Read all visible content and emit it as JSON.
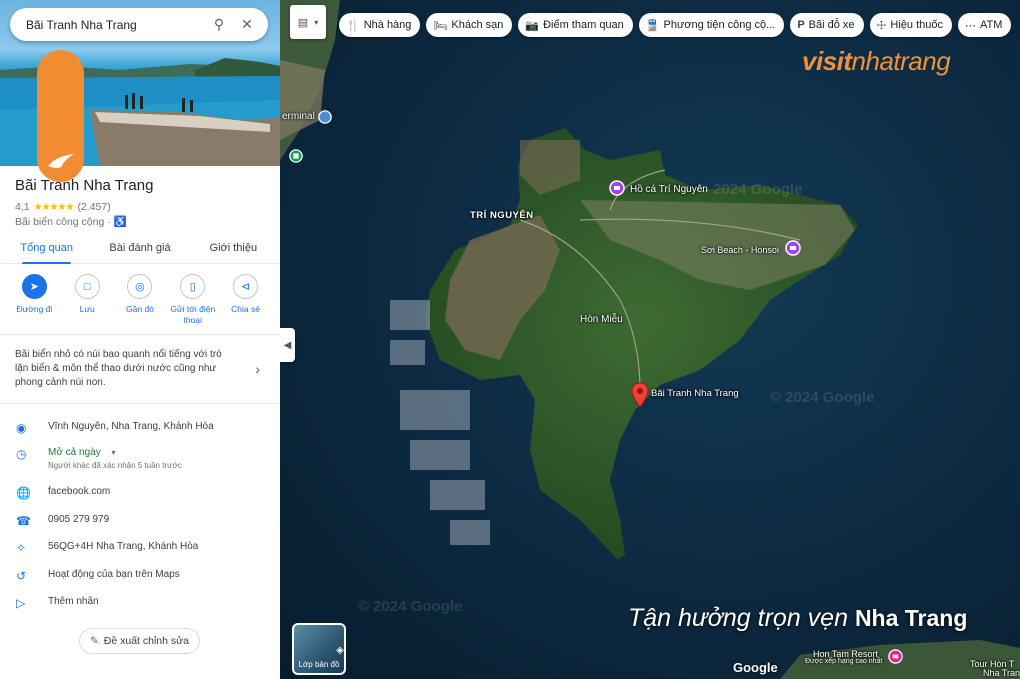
{
  "search": {
    "value": "Bãi Tranh Nha Trang"
  },
  "place": {
    "title": "Bãi Tranh Nha Trang",
    "rating": "4,1",
    "stars": "★★★★★",
    "review_count": "(2.457)",
    "category": "Bãi biển công cộng",
    "accessibility_icon": "accessible-icon"
  },
  "tabs": [
    {
      "label": "Tổng quan",
      "active": true
    },
    {
      "label": "Bài đánh giá",
      "active": false
    },
    {
      "label": "Giới thiệu",
      "active": false
    }
  ],
  "actions": [
    {
      "label": "Đường đi",
      "icon": "directions-icon"
    },
    {
      "label": "Lưu",
      "icon": "bookmark-icon"
    },
    {
      "label": "Gần đó",
      "icon": "nearby-icon"
    },
    {
      "label": "Gửi tới điện thoại",
      "icon": "send-to-phone-icon"
    },
    {
      "label": "Chia sẻ",
      "icon": "share-icon"
    }
  ],
  "description": "Bãi biển nhỏ có núi bao quanh nổi tiếng với trò lặn biển & môn thể thao dưới nước cũng như phong cảnh núi non.",
  "info": {
    "address": "Vĩnh Nguyên, Nha Trang, Khánh Hòa",
    "hours": "Mở cả ngày",
    "hours_note": "Người khác đã xác nhận 5 tuần trước",
    "website": "facebook.com",
    "phone": "0905 279 979",
    "plus_code": "56QG+4H Nha Trang, Khánh Hòa",
    "activity": "Hoạt động của bạn trên Maps",
    "label": "Thêm nhãn"
  },
  "suggest_edit": "Đề xuất chỉnh sửa",
  "chips": [
    {
      "label": "Nhà hàng",
      "icon": "restaurant-icon"
    },
    {
      "label": "Khách sạn",
      "icon": "hotel-icon"
    },
    {
      "label": "Điểm tham quan",
      "icon": "camera-icon"
    },
    {
      "label": "Phương tiện công cộ...",
      "icon": "transit-icon"
    },
    {
      "label": "Bãi đỗ xe",
      "icon": "parking-icon"
    },
    {
      "label": "Hiệu thuốc",
      "icon": "pharmacy-icon"
    },
    {
      "label": "ATM",
      "icon": "atm-icon"
    }
  ],
  "map": {
    "labels": {
      "terminal": "erminal",
      "ho_ca": "Hồ cá Trí Nguyên",
      "tri_nguyen": "TRÍ NGUYÊN",
      "sea_beach": "Sơi Beach - Honsoi",
      "hon_mieu": "Hòn Miễu",
      "bai_tranh": "Bãi Tranh Nha Trang",
      "hon_tam": "Hon Tam Resort",
      "hon_tam_sub": "Được xếp hạng cao nhất",
      "tour": "Tour Hòn T",
      "tour2": "Nha Tran"
    },
    "watermarks": [
      "© 2024 Google",
      "© 2024 Google",
      "© 2024 Google"
    ],
    "google_logo": "Google",
    "layer_label": "Lớp bản đồ"
  },
  "brand": {
    "bold": "visit",
    "light": "nhatrang"
  },
  "slogan": {
    "script": "Tận hưởng trọn vẹn",
    "bold": "Nha Trang"
  },
  "colors": {
    "accent": "#1a73e8",
    "brand_orange": "#f18c32",
    "open_green": "#188038",
    "pin_red": "#ea4335"
  }
}
